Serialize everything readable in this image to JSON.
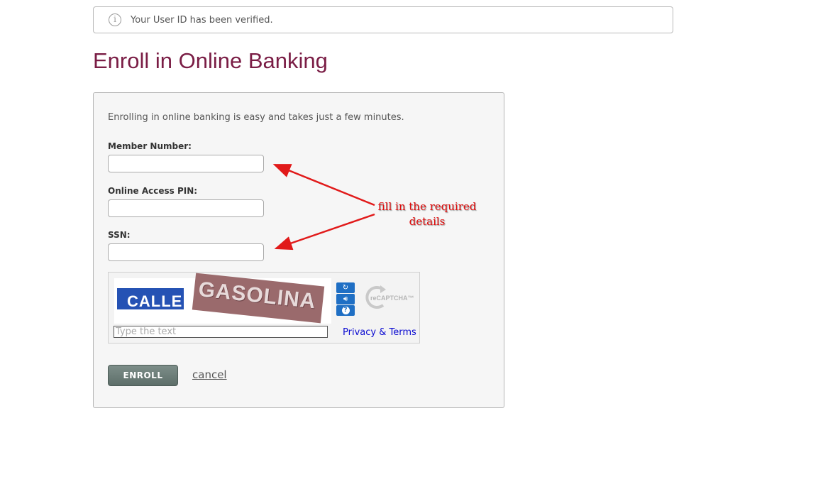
{
  "notice": {
    "text": "Your User ID has been verified.",
    "icon": "info-icon"
  },
  "page": {
    "title": "Enroll in Online Banking",
    "title_color": "#7a1d45"
  },
  "form": {
    "intro": "Enrolling in online banking is easy and takes just a few minutes.",
    "member_number_label": "Member Number:",
    "member_number_value": "",
    "pin_label": "Online Access PIN:",
    "pin_value": "",
    "ssn_label": "SSN:",
    "ssn_value": ""
  },
  "captcha": {
    "word_1": "CALLE",
    "word_2": "GASOLINA",
    "placeholder": "Type the text",
    "privacy_link": "Privacy & Terms",
    "logo_text": "reCAPTCHA™",
    "controls": [
      "refresh-icon",
      "audio-icon",
      "help-icon"
    ]
  },
  "actions": {
    "enroll_label": "ENROLL",
    "cancel_label": "cancel"
  },
  "annotation": {
    "line_1": "fill in the required",
    "line_2": "details",
    "color": "#e10d0d"
  }
}
